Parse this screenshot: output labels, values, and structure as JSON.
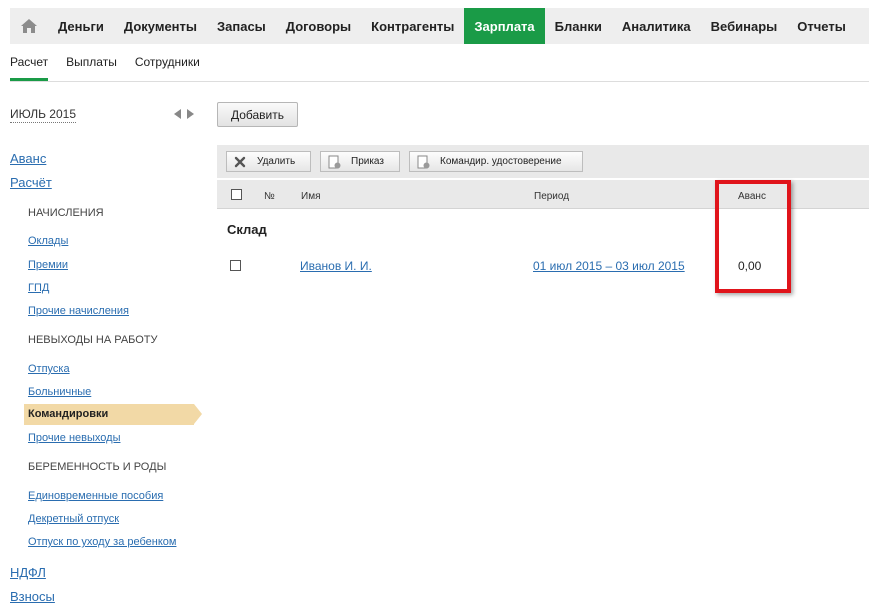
{
  "nav": {
    "items": [
      "Деньги",
      "Документы",
      "Запасы",
      "Договоры",
      "Контрагенты",
      "Зарплата",
      "Бланки",
      "Аналитика",
      "Вебинары",
      "Отчеты"
    ],
    "active": "Зарплата"
  },
  "subnav": {
    "items": [
      "Расчет",
      "Выплаты",
      "Сотрудники"
    ],
    "active": "Расчет"
  },
  "sidebar": {
    "month": "ИЮЛЬ 2015",
    "avans": "Аванс",
    "raschet": "Расчёт",
    "section_accruals": "НАЧИСЛЕНИЯ",
    "link_oklady": "Оклады",
    "link_premii": "Премии",
    "link_gpd": "ГПД",
    "link_other_accruals": "Прочие начисления",
    "section_absences": "НЕВЫХОДЫ НА РАБОТУ",
    "link_otpuska": "Отпуска",
    "link_bolnichnye": "Больничные",
    "active_item": "Командировки",
    "link_other_absences": "Прочие невыходы",
    "section_pregnancy": "БЕРЕМЕННОСТЬ И РОДЫ",
    "link_lump_sum": "Единовременные пособия",
    "link_maternity": "Декретный отпуск",
    "link_childcare": "Отпуск по уходу за ребенком",
    "ndfl": "НДФЛ",
    "vznosy": "Взносы"
  },
  "main": {
    "add_button": "Добавить",
    "toolbar": {
      "delete": "Удалить",
      "order": "Приказ",
      "certificate": "Командир. удостоверение"
    },
    "columns": {
      "number": "№",
      "name": "Имя",
      "period": "Период",
      "advance": "Аванс"
    },
    "group": "Склад",
    "row": {
      "name": "Иванов И. И.",
      "period": "01 июл 2015 – 03 июл 2015",
      "advance": "0,00"
    }
  },
  "colors": {
    "accent": "#1a9b47",
    "link": "#2a6db0",
    "highlight": "#e0141b",
    "active_side": "#f2d9a6"
  }
}
